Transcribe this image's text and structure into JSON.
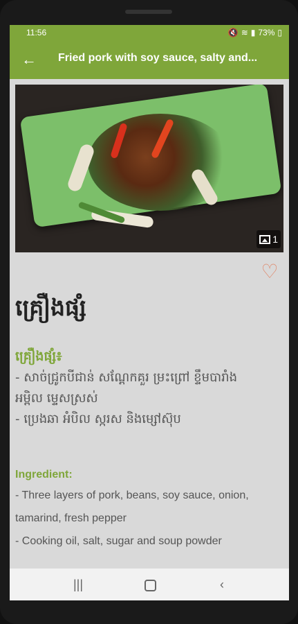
{
  "status": {
    "time": "11:56",
    "battery": "73%"
  },
  "appbar": {
    "title": "Fried pork with soy sauce, salty and...",
    "back_icon": "back-arrow-icon"
  },
  "photo": {
    "count": "1"
  },
  "recipe": {
    "title_kh": "គ្រឿងផ្សំ",
    "kh_section": {
      "heading": "គ្រឿងផ្សំ៖",
      "lines": [
        "- សាច់ជ្រូកបីជាន់ សណ្ដែកគួរ ម្រះព្រៅ ខ្ទឹមបារាំង",
        "អម្ពិល ម្ទេសស្រស់",
        "- ប្រេងឆា អំបិល ស្ករស និងម្សៅស៊ុប"
      ]
    },
    "en_section": {
      "heading": "Ingredient:",
      "lines": [
        "- Three layers of pork, beans, soy sauce, onion,",
        "tamarind, fresh pepper",
        "- Cooking oil, salt, sugar and soup powder"
      ]
    }
  },
  "colors": {
    "accent": "#7fa63a",
    "heart": "#e0886b"
  }
}
